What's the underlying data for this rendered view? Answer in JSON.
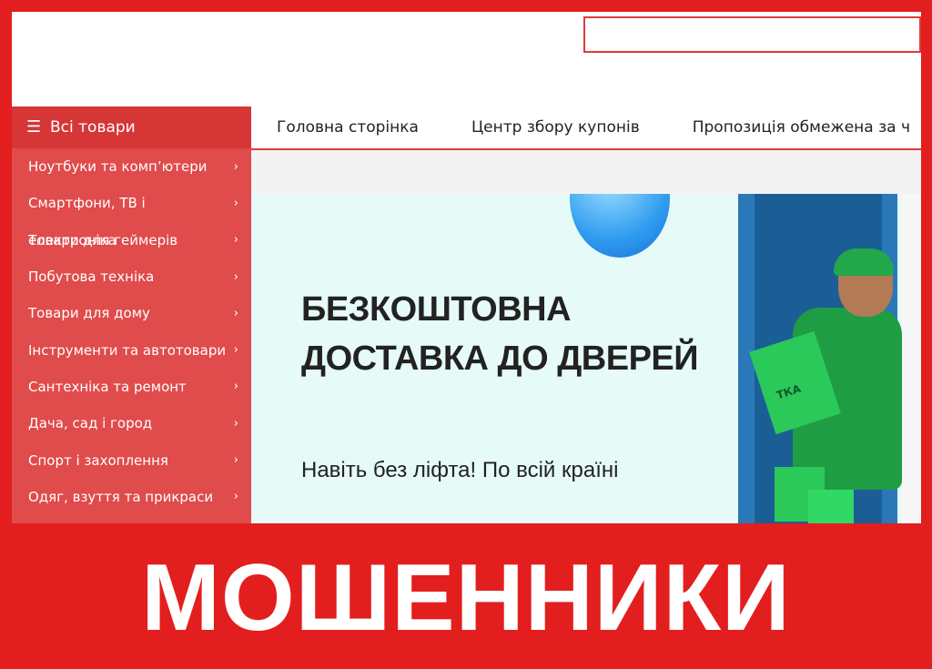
{
  "categories_button": {
    "icon": "hamburger-menu-icon",
    "label": "Всі товари"
  },
  "nav": {
    "items": [
      "Головна сторінка",
      "Центр збору купонів",
      "Пропозиція обмежена за ч"
    ]
  },
  "sidebar": {
    "items": [
      {
        "label": "Ноутбуки та комп’ютери"
      },
      {
        "label": "Смартфони, ТВ і"
      },
      {
        "label": "Товари для геймерів",
        "overlap": "електроніка"
      },
      {
        "label": "Побутова техніка"
      },
      {
        "label": "Товари для дому"
      },
      {
        "label": "Інструменти та автотовари"
      },
      {
        "label": "Сантехніка та ремонт"
      },
      {
        "label": "Дача, сад і город"
      },
      {
        "label": "Спорт і захоплення"
      },
      {
        "label": "Одяг, взуття та прикраси"
      }
    ]
  },
  "banner": {
    "line1": "БЕЗКОШТОВНА",
    "line2": "ДОСТАВКА ДО ДВЕРЕЙ",
    "subtitle": "Навіть без ліфта! По всій країні",
    "box_text": "ТКА"
  },
  "overlay": {
    "text": "МОШЕННИКИ"
  },
  "colors": {
    "frame_red": "#e31e1e",
    "menu_red": "#e04b4b",
    "accent": "#d63636"
  }
}
